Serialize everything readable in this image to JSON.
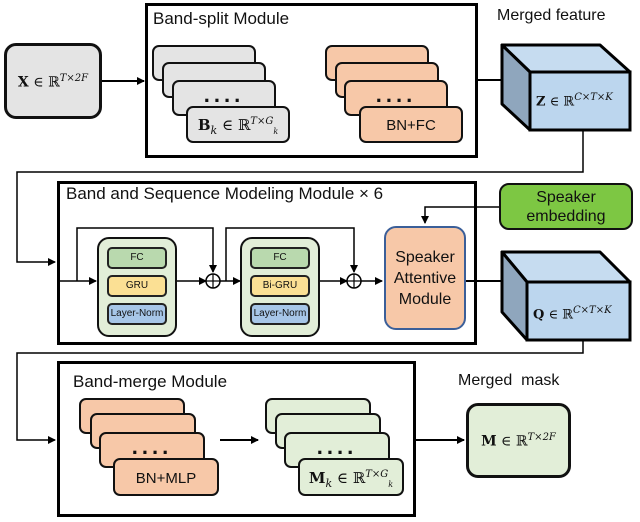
{
  "input": {
    "symbol": "X",
    "set": "ℝ",
    "exponent": "T×2F"
  },
  "band_split_module": {
    "title": "Band-split Module",
    "band_cards": {
      "dots": "....",
      "symbol": "B",
      "subscript": "k",
      "set": "ℝ",
      "exponent": "T×G",
      "exponent_sub": "k"
    },
    "fc_cards": {
      "dots": "....",
      "label": "BN+FC"
    }
  },
  "merged_feature": {
    "title": "Merged feature",
    "symbol": "Z",
    "set": "ℝ",
    "exponent": "C×T×K"
  },
  "bsm_module": {
    "title": "Band and Sequence Modeling Module × 6",
    "block1": {
      "fc": "FC",
      "rnn": "GRU",
      "norm": "Layer-Norm"
    },
    "block2": {
      "fc": "FC",
      "rnn": "Bi-GRU",
      "norm": "Layer-Norm"
    },
    "sum_symbol": "⊕",
    "speaker_attentive": [
      "Speaker",
      "Attentive",
      "Module"
    ]
  },
  "speaker_embedding": [
    "Speaker",
    "embedding"
  ],
  "q_feature": {
    "symbol": "Q",
    "set": "ℝ",
    "exponent": "C×T×K"
  },
  "band_merge_module": {
    "title": "Band-merge Module",
    "mlp_cards": {
      "dots": "....",
      "label": "BN+MLP"
    },
    "mask_cards": {
      "dots": "....",
      "symbol": "M",
      "subscript": "k",
      "set": "ℝ",
      "exponent": "T×G",
      "exponent_sub": "k"
    }
  },
  "merged_mask": {
    "title": "Merged  mask",
    "symbol": "M",
    "set": "ℝ",
    "exponent": "T×2F"
  },
  "colors": {
    "gray_card": "#e4e4e4",
    "orange_card": "#f7c8a8",
    "light_green": "#e2eed8",
    "fc_green": "#b9d9ae",
    "gru_yellow": "#fbe094",
    "norm_blue": "#a7c6e8",
    "speaker_green": "#7dc743",
    "cube_front": "#bcd6ee",
    "cube_side": "#8fa6bd"
  }
}
